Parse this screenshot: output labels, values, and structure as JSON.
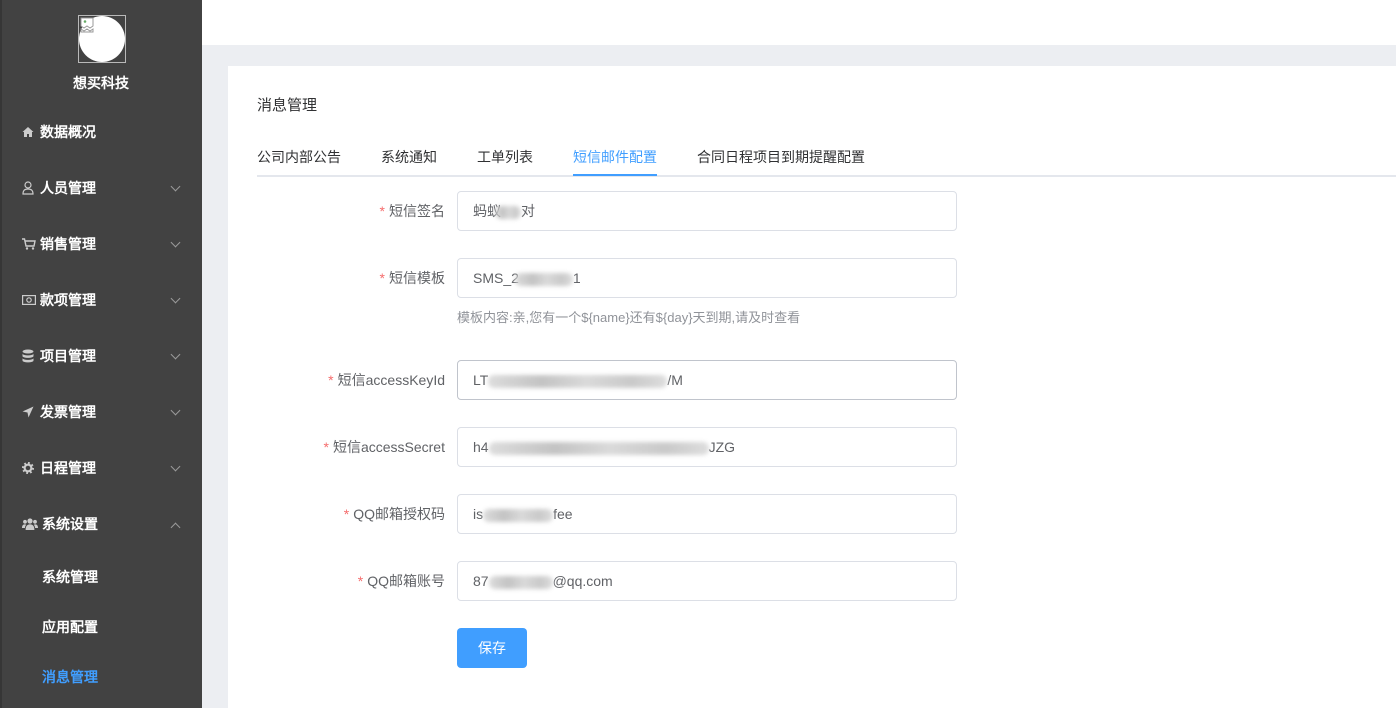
{
  "sidebar": {
    "brand": "想买科技",
    "menu": [
      {
        "label": "数据概况",
        "icon": "home-icon"
      },
      {
        "label": "人员管理",
        "icon": "user-icon",
        "expanded": false
      },
      {
        "label": "销售管理",
        "icon": "cart-icon",
        "expanded": false
      },
      {
        "label": "款项管理",
        "icon": "money-icon",
        "expanded": false
      },
      {
        "label": "项目管理",
        "icon": "database-icon",
        "expanded": false
      },
      {
        "label": "发票管理",
        "icon": "paper-plane-icon",
        "expanded": false
      },
      {
        "label": "日程管理",
        "icon": "gear-icon",
        "expanded": false
      },
      {
        "label": "系统设置",
        "icon": "users-icon",
        "expanded": true,
        "children": [
          {
            "label": "系统管理"
          },
          {
            "label": "应用配置"
          },
          {
            "label": "消息管理",
            "active": true
          }
        ]
      }
    ]
  },
  "page": {
    "title": "消息管理",
    "tabs": [
      {
        "label": "公司内部公告"
      },
      {
        "label": "系统通知"
      },
      {
        "label": "工单列表"
      },
      {
        "label": "短信邮件配置",
        "active": true
      },
      {
        "label": "合同日程项目到期提醒配置"
      }
    ]
  },
  "form": {
    "required_mark": "*",
    "fields": [
      {
        "label": "短信签名",
        "required": true,
        "value_visible_start": "蚂蚁",
        "value_visible_end": "对",
        "value_masked": true
      },
      {
        "label": "短信模板",
        "required": true,
        "value_visible_start": "SMS_2",
        "value_visible_end": "1",
        "value_masked": true,
        "hint": "模板内容:亲,您有一个${name}还有${day}天到期,请及时查看"
      },
      {
        "label": "短信accessKeyId",
        "required": true,
        "value_visible_start": "LT",
        "value_visible_end": "/M",
        "value_masked": true,
        "hovered": true
      },
      {
        "label": "短信accessSecret",
        "required": true,
        "value_visible_start": "h4",
        "value_visible_end": "JZG",
        "value_masked": true
      },
      {
        "label": "QQ邮箱授权码",
        "required": true,
        "value_visible_start": "is",
        "value_visible_end": "fee",
        "value_masked": true
      },
      {
        "label": "QQ邮箱账号",
        "required": true,
        "value_visible_start": "87",
        "value_visible_end": "@qq.com",
        "value_masked": true
      }
    ],
    "save_label": "保存"
  },
  "colors": {
    "sidebar_bg": "#424242",
    "page_bg": "#ECEEF2",
    "accent": "#409EFF",
    "required": "#F56C6C"
  }
}
